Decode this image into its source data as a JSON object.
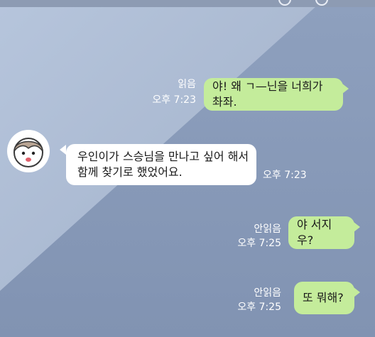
{
  "messages": [
    {
      "side": "right",
      "text": "야! 왜 ㄱ—닌을 너희가 촤좌.",
      "read_status": "읽음",
      "time": "오후 7:23"
    },
    {
      "side": "left",
      "line1": "우인이가 스승님을 만나고 싶어 해서",
      "line2": "함께 찾기로 했었어요.",
      "time": "오후 7:23"
    },
    {
      "side": "right",
      "text": "야 서지우?",
      "read_status": "안읽음",
      "time": "오후 7:25"
    },
    {
      "side": "right",
      "text": "또 뭐해?",
      "read_status": "안읽음",
      "time": "오후 7:25"
    }
  ],
  "icons": [
    "back-icon",
    "search-icon",
    "menu-icon"
  ]
}
